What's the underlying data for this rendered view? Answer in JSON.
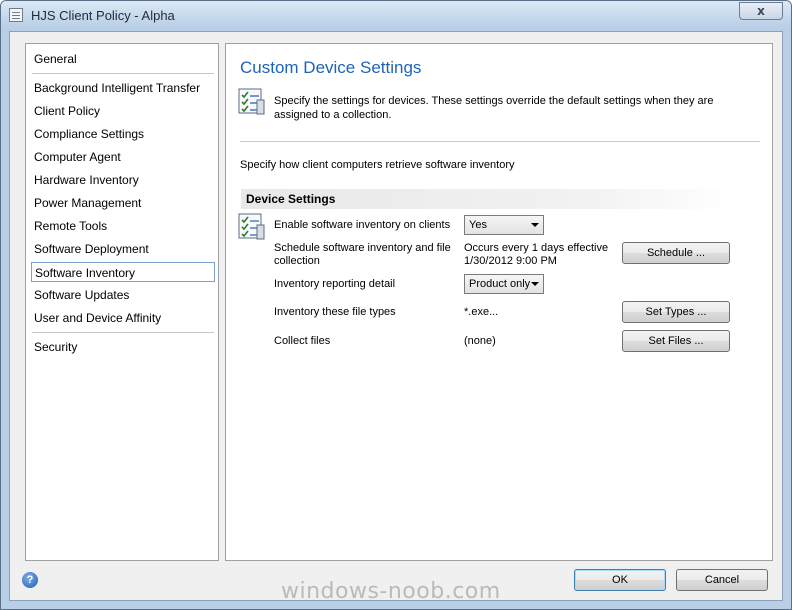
{
  "window": {
    "title": "HJS Client Policy - Alpha",
    "close_glyph": "x"
  },
  "nav": {
    "items": [
      {
        "label": "General"
      },
      {
        "label": "Background Intelligent Transfer"
      },
      {
        "label": "Client Policy"
      },
      {
        "label": "Compliance Settings"
      },
      {
        "label": "Computer Agent"
      },
      {
        "label": "Hardware Inventory"
      },
      {
        "label": "Power Management"
      },
      {
        "label": "Remote Tools"
      },
      {
        "label": "Software Deployment"
      },
      {
        "label": "Software Inventory"
      },
      {
        "label": "Software Updates"
      },
      {
        "label": "User and Device Affinity"
      },
      {
        "label": "Security"
      }
    ],
    "selected": "Software Inventory"
  },
  "content": {
    "title": "Custom Device Settings",
    "description": "Specify the settings for devices. These settings override the default settings when they are assigned to a collection.",
    "subdescription": "Specify how client computers retrieve software inventory",
    "section_title": "Device Settings",
    "settings": {
      "enable": {
        "label": "Enable software inventory on clients",
        "value": "Yes"
      },
      "schedule": {
        "label": "Schedule software inventory and file collection",
        "value": "Occurs every 1 days effective 1/30/2012 9:00 PM",
        "button": "Schedule ..."
      },
      "reporting": {
        "label": "Inventory reporting detail",
        "value": "Product only"
      },
      "file_types": {
        "label": "Inventory these file types",
        "value": "*.exe...",
        "button": "Set Types ..."
      },
      "collect": {
        "label": "Collect files",
        "value": "(none)",
        "button": "Set Files ..."
      }
    }
  },
  "footer": {
    "help_glyph": "?",
    "ok": "OK",
    "cancel": "Cancel"
  },
  "watermark": "windows-noob.com",
  "colors": {
    "title_blue": "#1e64b4",
    "selection_border": "#7da2ce"
  }
}
